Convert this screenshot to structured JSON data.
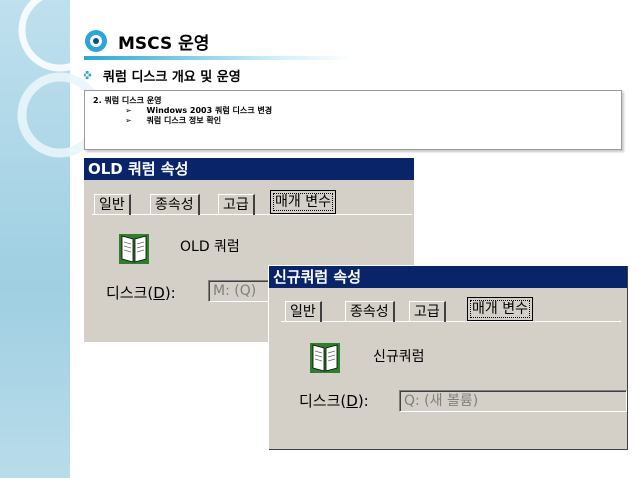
{
  "slide": {
    "title": "MSCS 운영",
    "section_heading": "쿼럼 디스크 개요 및 운영"
  },
  "notes": {
    "heading": "2.   쿼럼 디스크 운영",
    "items": [
      "Windows 2003 쿼럼 디스크 변경",
      "쿼럼 디스크 정보 확인"
    ],
    "bullet": "➢"
  },
  "old_dialog": {
    "title": "OLD 쿼럼 속성",
    "tabs": [
      "일반",
      "종속성",
      "고급",
      "매개 변수"
    ],
    "resource_name": "OLD 쿼럼",
    "disk_label_prefix": "디스크(",
    "disk_label_key": "D",
    "disk_label_suffix": "):",
    "disk_value": "M: (Q)"
  },
  "new_dialog": {
    "title": "신규쿼럼 속성",
    "tabs": [
      "일반",
      "종속성",
      "고급",
      "매개 변수"
    ],
    "resource_name": "신규쿼럼",
    "disk_label_prefix": "디스크(",
    "disk_label_key": "D",
    "disk_label_suffix": "):",
    "disk_value": "Q: (새 볼륨)"
  },
  "colors": {
    "dialog_title_bar": "#0a246a",
    "dialog_face": "#d4d0c8",
    "accent": "#2aa7d6"
  }
}
